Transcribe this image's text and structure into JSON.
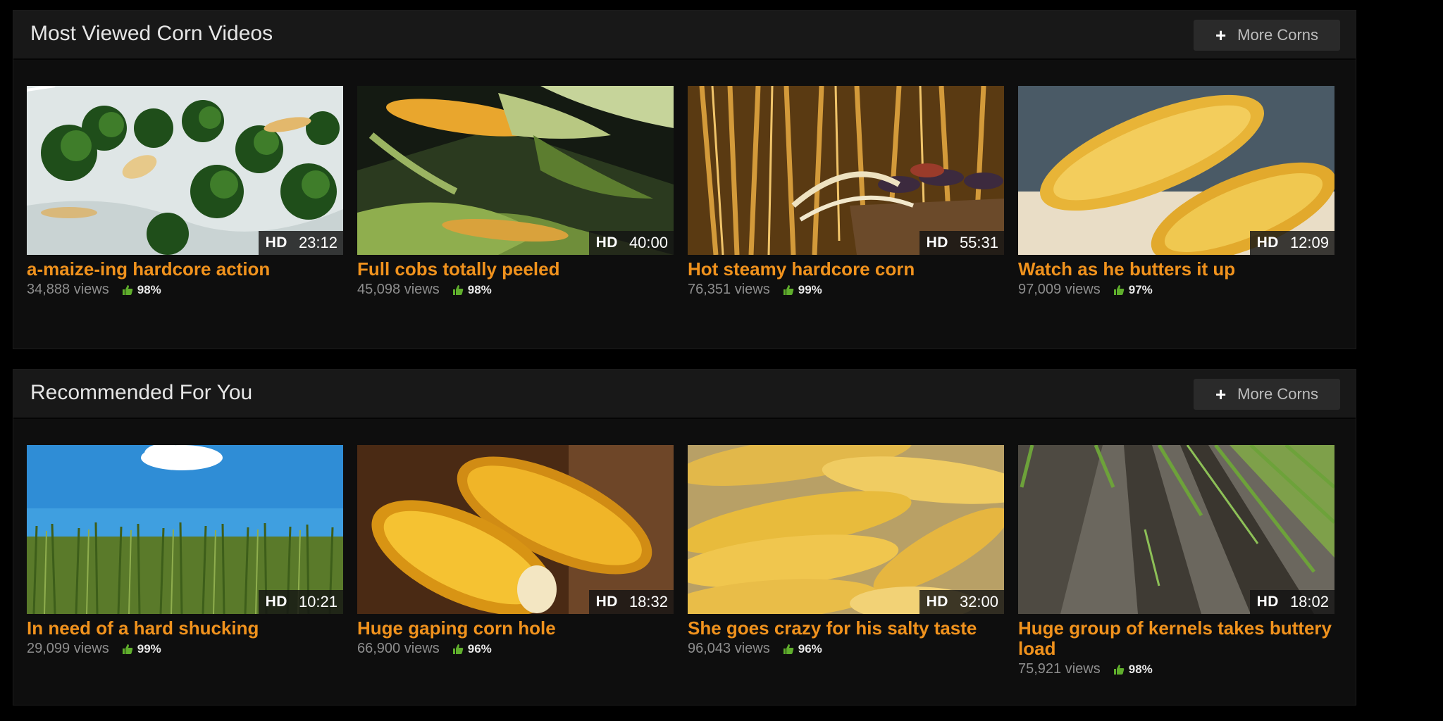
{
  "sections": [
    {
      "title": "Most Viewed Corn Videos",
      "more_label": "More Corns",
      "videos": [
        {
          "quality": "HD",
          "duration": "23:12",
          "title": "a-maize-ing hardcore action",
          "views": "34,888 views",
          "rating": "98%",
          "thumb": "broccoli"
        },
        {
          "quality": "HD",
          "duration": "40:00",
          "title": "Full cobs totally peeled",
          "views": "45,098 views",
          "rating": "98%",
          "thumb": "husk"
        },
        {
          "quality": "HD",
          "duration": "55:31",
          "title": "Hot steamy hardcore corn",
          "views": "76,351 views",
          "rating": "99%",
          "thumb": "stalks"
        },
        {
          "quality": "HD",
          "duration": "12:09",
          "title": "Watch as he butters it up",
          "views": "97,009 views",
          "rating": "97%",
          "thumb": "cobs"
        }
      ]
    },
    {
      "title": "Recommended For You",
      "more_label": "More Corns",
      "videos": [
        {
          "quality": "HD",
          "duration": "10:21",
          "title": "In need of a hard shucking",
          "views": "29,099 views",
          "rating": "99%",
          "thumb": "field"
        },
        {
          "quality": "HD",
          "duration": "18:32",
          "title": "Huge gaping corn hole",
          "views": "66,900 views",
          "rating": "96%",
          "thumb": "broken-cob"
        },
        {
          "quality": "HD",
          "duration": "32:00",
          "title": "She goes crazy for his salty taste",
          "views": "96,043 views",
          "rating": "96%",
          "thumb": "boiling"
        },
        {
          "quality": "HD",
          "duration": "18:02",
          "title": "Huge group of kernels takes buttery load",
          "views": "75,921 views",
          "rating": "98%",
          "thumb": "rows"
        }
      ]
    }
  ],
  "icons": {
    "more": "plus-icon",
    "rating": "thumbs-up-icon"
  },
  "colors": {
    "accent": "#f0921d",
    "rating_icon": "#5fae2c",
    "background": "#000000",
    "panel": "#0e0e0e"
  }
}
